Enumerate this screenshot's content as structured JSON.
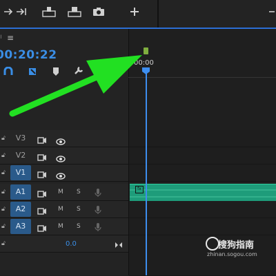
{
  "toolbar": {
    "icons": [
      "in-out-icon",
      "go-to-in-icon",
      "lift-icon",
      "extract-icon",
      "camera-icon",
      "add-icon"
    ]
  },
  "panel": {
    "menu_glyph": "≡",
    "tick_glyph": "ı",
    "timecode": "00:20:22",
    "ruler_time": "00:00",
    "value_readout": "0.0"
  },
  "tracks": {
    "video": [
      {
        "label": "V3",
        "active": false
      },
      {
        "label": "V2",
        "active": false
      },
      {
        "label": "V1",
        "active": true
      }
    ],
    "audio": [
      {
        "label": "A1",
        "active": true,
        "mute": "M",
        "solo": "S"
      },
      {
        "label": "A2",
        "active": true,
        "mute": "M",
        "solo": "S"
      },
      {
        "label": "A3",
        "active": true,
        "mute": "M",
        "solo": "S"
      }
    ]
  },
  "clip": {
    "fx_label": "fx",
    "color": "#1e9c7a"
  },
  "watermark": {
    "title": "搜狗指南",
    "url": "zhinan.sogou.com"
  },
  "colors": {
    "accent_blue": "#3a8ee6",
    "playhead": "#3d8ef0",
    "marker": "#7fae3f",
    "annotation_arrow": "#22e022",
    "audio_clip": "#1e9c7a"
  }
}
